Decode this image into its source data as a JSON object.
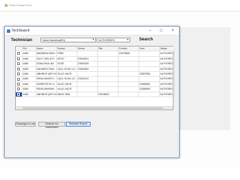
{
  "background": {
    "title": "Plant Control Prod"
  },
  "window": {
    "title": "TechSearch"
  },
  "filters": {
    "label": "Technician",
    "technician": "Maria Santolina(891)",
    "status": "AUTHORIZED",
    "search_label": "Search"
  },
  "table": {
    "columns": [
      "",
      "Pid",
      "Name",
      "Toolset",
      "Server",
      "Site",
      "Fromhs",
      "Ums",
      "Status"
    ],
    "rows": [
      {
        "pid": "4465",
        "name": "BANSARA DAN L",
        "toolset": "PFBD",
        "server": "",
        "site": "",
        "fromhs": "Z3478966",
        "ums": "",
        "status": "AUTHORIS"
      },
      {
        "pid": "4465",
        "name": "SULIT SEN JOY",
        "toolset": "WTDC",
        "server": "Z3000301",
        "site": "",
        "fromhs": "",
        "ums": "",
        "status": "AUTHORIS"
      },
      {
        "pid": "4465",
        "name": "SONA PAUL BA",
        "toolset": "SCRE",
        "server": "Z3000328",
        "site": "",
        "fromhs": "",
        "ums": "",
        "status": "AUTHORIS"
      },
      {
        "pid": "4465",
        "name": "DAHAEEV RAVI",
        "toolset": "CACL HCHG LO",
        "server": "Z3000384",
        "site": "",
        "fromhs": "",
        "ums": "",
        "status": "AUTHORIS"
      },
      {
        "pid": "4465",
        "name": "ABHIRUP (28Y INI",
        "toolset": "VA.UC.VACR",
        "server": "",
        "site": "",
        "fromhs": "",
        "ums": "Z3697506",
        "status": "AUTHORIS"
      },
      {
        "pid": "4465",
        "name": "RENU BHARTI L",
        "toolset": "CACL HCHG LO",
        "server": "Z3015142",
        "site": "",
        "fromhs": "",
        "ums": "",
        "status": "AUTHORIS"
      },
      {
        "pid": "4465",
        "name": "SUBIR RE ED IJ",
        "toolset": "VA.UC.VACR",
        "server": "",
        "site": "",
        "fromhs": "",
        "ums": "Z3456962",
        "status": "AUTHORIS"
      },
      {
        "pid": "4465",
        "name": "RENU BHARAN",
        "toolset": "VA.UC.VACR",
        "server": "",
        "site": "",
        "fromhs": "",
        "ums": "Z3456963",
        "status": "AUTHORIS"
      },
      {
        "pid": "4465",
        "name": "ABHIRUP (28Y INI",
        "toolset": "NMHC RBS",
        "server": "",
        "site": "Z3478502",
        "fromhs": "",
        "ums": "",
        "status": "AUTHORIS"
      }
    ]
  },
  "buttons": {
    "reassign": "Reassign to Lab",
    "refresh": "Refresh for Authorized",
    "release": "Release Report"
  }
}
